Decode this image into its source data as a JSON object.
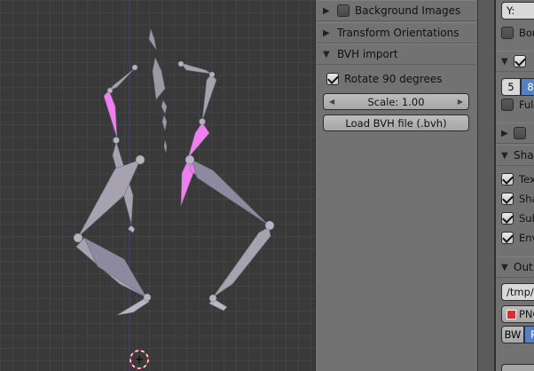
{
  "tool_panel": {
    "background_images": {
      "label": "Background Images",
      "checked": false,
      "collapsed": true
    },
    "transform_orientations": {
      "label": "Transform Orientations",
      "collapsed": true
    },
    "bvh_import": {
      "label": "BVH import",
      "collapsed": false,
      "rotate_checkbox": {
        "label": "Rotate 90 degrees",
        "checked": true
      },
      "scale_field": "Scale: 1.00",
      "load_button": "Load BVH file (.bvh)"
    }
  },
  "properties_panel": {
    "top_field": "Y: ",
    "bone_toggle": "Bon",
    "frame_start": "5",
    "frame_end": "8",
    "full_toggle": "Ful",
    "shading_header": "Sha",
    "shading_options": [
      "Tex",
      "Sha",
      "Sub",
      "Env"
    ],
    "output_header": "Out",
    "output_path": "/tmp/",
    "file_format": "PNG",
    "color_mode_bw": "BW",
    "color_mode_next": "R"
  },
  "colors": {
    "viewport_bg": "#393939",
    "bone_gray": "#a7a2b0",
    "bone_selected": "#f07ef0",
    "panel_bg": "#727272",
    "accent_blue": "#5680c2"
  },
  "icons": {
    "expand": "triangle-right-icon",
    "collapse": "triangle-down-icon",
    "cursor": "3d-cursor-icon"
  }
}
